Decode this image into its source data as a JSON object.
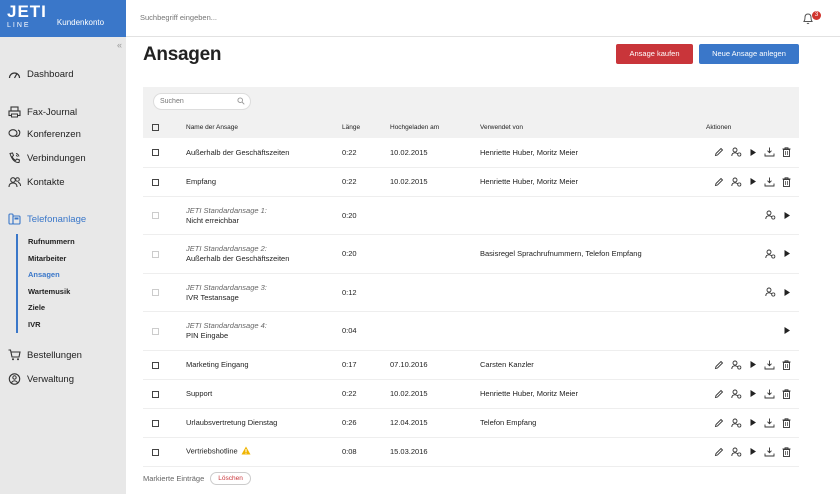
{
  "app": {
    "logo_text": "JETI",
    "logo_sub": "LINE",
    "account_label": "Kundenkonto"
  },
  "topbar": {
    "search_placeholder": "Suchbegriff eingeben...",
    "notification_count": "3"
  },
  "sidebar": {
    "dashboard": "Dashboard",
    "fax_journal": "Fax-Journal",
    "konferenzen": "Konferenzen",
    "verbindungen": "Verbindungen",
    "kontakte": "Kontakte",
    "telefonanlage": "Telefonanlage",
    "sub": [
      "Rufnummern",
      "Mitarbeiter",
      "Ansagen",
      "Wartemusik",
      "Ziele",
      "IVR"
    ],
    "bestellungen": "Bestellungen",
    "verwaltung": "Verwaltung"
  },
  "page": {
    "title": "Ansagen",
    "buy_label": "Ansage kaufen",
    "new_label": "Neue Ansage anlegen"
  },
  "table": {
    "search_placeholder": "Suchen",
    "headers": {
      "name": "Name der Ansage",
      "length": "Länge",
      "uploaded": "Hochgeladen am",
      "used_by": "Verwendet von",
      "actions": "Aktionen"
    },
    "rows": [
      {
        "name": "Außerhalb der Geschäftszeiten",
        "length": "0:22",
        "uploaded": "10.02.2015",
        "used_by": "Henriette Huber, Moritz Meier"
      },
      {
        "name": "Empfang",
        "length": "0:22",
        "uploaded": "10.02.2015",
        "used_by": "Henriette Huber, Moritz Meier"
      },
      {
        "std": "JETI Standardansage 1:",
        "name": "Nicht erreichbar",
        "length": "0:20",
        "uploaded": "",
        "used_by": ""
      },
      {
        "std": "JETI Standardansage 2:",
        "name": "Außerhalb der Geschäftszeiten",
        "length": "0:20",
        "uploaded": "",
        "used_by": "Basisregel Sprachrufnummern, Telefon Empfang"
      },
      {
        "std": "JETI Standardansage 3:",
        "name": "IVR Testansage",
        "length": "0:12",
        "uploaded": "",
        "used_by": ""
      },
      {
        "std": "JETI Standardansage 4:",
        "name": "PIN Eingabe",
        "length": "0:04",
        "uploaded": "",
        "used_by": ""
      },
      {
        "name": "Marketing Eingang",
        "length": "0:17",
        "uploaded": "07.10.2016",
        "used_by": "Carsten Kanzler"
      },
      {
        "name": "Support",
        "length": "0:22",
        "uploaded": "10.02.2015",
        "used_by": "Henriette Huber, Moritz Meier"
      },
      {
        "name": "Urlaubsvertretung Dienstag",
        "length": "0:26",
        "uploaded": "12.04.2015",
        "used_by": "Telefon Empfang"
      },
      {
        "name": "Vertriebshotline",
        "length": "0:08",
        "uploaded": "15.03.2016",
        "used_by": ""
      }
    ]
  },
  "footer": {
    "marked_label": "Markierte Einträge",
    "delete_label": "Löschen"
  },
  "colors": {
    "primary": "#3a77c9",
    "danger": "#c9353a",
    "warning": "#f0b400"
  }
}
